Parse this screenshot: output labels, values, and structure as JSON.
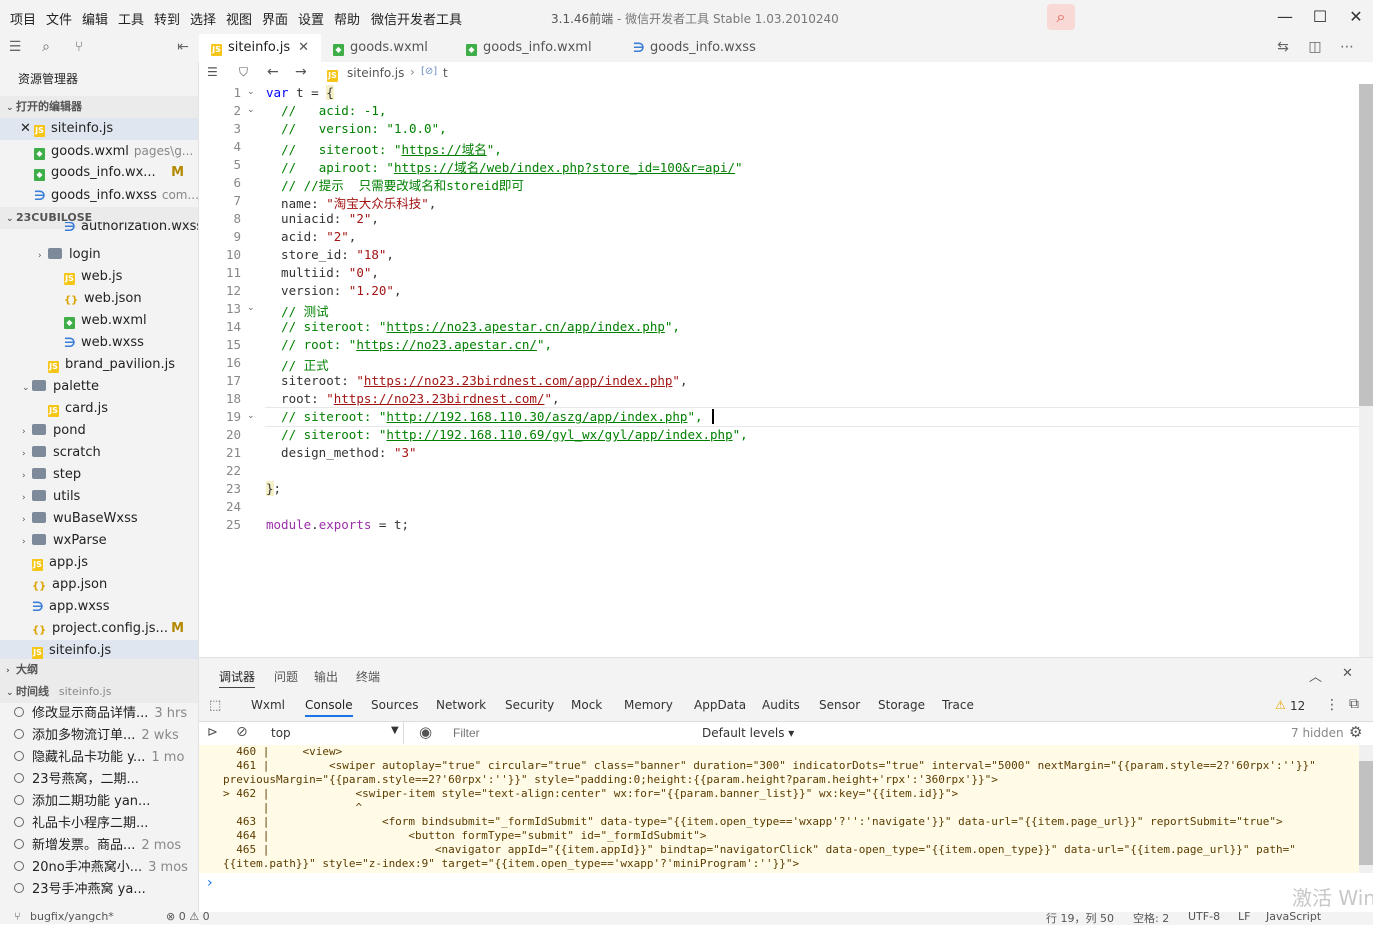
{
  "menu": [
    "项目",
    "文件",
    "编辑",
    "工具",
    "转到",
    "选择",
    "视图",
    "界面",
    "设置",
    "帮助",
    "微信开发者工具"
  ],
  "window": {
    "title_version": "3.1.46前端",
    "title_rest": " - 微信开发者工具 Stable 1.03.2010240"
  },
  "tabs": [
    {
      "label": "siteinfo.js",
      "type": "js",
      "active": true
    },
    {
      "label": "goods.wxml",
      "type": "wxml",
      "active": false
    },
    {
      "label": "goods_info.wxml",
      "type": "wxml",
      "active": false
    },
    {
      "label": "goods_info.wxss",
      "type": "wxss",
      "active": false
    }
  ],
  "sidebar": {
    "header": "资源管理器",
    "open_editors_title": "打开的编辑器",
    "open_editors": [
      {
        "label": "siteinfo.js",
        "type": "js",
        "hint": "",
        "mod": ""
      },
      {
        "label": "goods.wxml",
        "type": "wxml",
        "hint": "pages\\g...",
        "mod": ""
      },
      {
        "label": "goods_info.wx...",
        "type": "wxml",
        "hint": "",
        "mod": "M"
      },
      {
        "label": "goods_info.wxss",
        "type": "wxss",
        "hint": "com...",
        "mod": ""
      }
    ],
    "project_title": "23CUBILOSE",
    "tree": [
      {
        "label": "authorization.wxss",
        "type": "wxss",
        "indent": 3,
        "chev": ""
      },
      {
        "label": "login",
        "type": "folder",
        "indent": 2,
        "chev": "›"
      },
      {
        "label": "web.js",
        "type": "js",
        "indent": 3,
        "chev": ""
      },
      {
        "label": "web.json",
        "type": "json",
        "indent": 3,
        "chev": ""
      },
      {
        "label": "web.wxml",
        "type": "wxml",
        "indent": 3,
        "chev": ""
      },
      {
        "label": "web.wxss",
        "type": "wxss",
        "indent": 3,
        "chev": ""
      },
      {
        "label": "brand_pavilion.js",
        "type": "js",
        "indent": 2,
        "chev": ""
      },
      {
        "label": "palette",
        "type": "folder",
        "indent": 1,
        "chev": "⌄"
      },
      {
        "label": "card.js",
        "type": "js",
        "indent": 2,
        "chev": ""
      },
      {
        "label": "pond",
        "type": "folder",
        "indent": 1,
        "chev": "›"
      },
      {
        "label": "scratch",
        "type": "folder",
        "indent": 1,
        "chev": "›"
      },
      {
        "label": "step",
        "type": "folder",
        "indent": 1,
        "chev": "›"
      },
      {
        "label": "utils",
        "type": "folder",
        "indent": 1,
        "chev": "›"
      },
      {
        "label": "wuBaseWxss",
        "type": "folder",
        "indent": 1,
        "chev": "›"
      },
      {
        "label": "wxParse",
        "type": "folder",
        "indent": 1,
        "chev": "›"
      },
      {
        "label": "app.js",
        "type": "js",
        "indent": 1,
        "chev": ""
      },
      {
        "label": "app.json",
        "type": "json",
        "indent": 1,
        "chev": ""
      },
      {
        "label": "app.wxss",
        "type": "wxss",
        "indent": 1,
        "chev": ""
      },
      {
        "label": "project.config.js...",
        "type": "json",
        "indent": 1,
        "chev": "",
        "mod": "M"
      },
      {
        "label": "siteinfo.js",
        "type": "js",
        "indent": 1,
        "chev": "",
        "selected": true
      }
    ],
    "outline_title": "大纲",
    "timeline_title": "时间线",
    "timeline_file": "siteinfo.js",
    "timeline": [
      {
        "label": "修改显示商品详情...",
        "time": "3 hrs"
      },
      {
        "label": "添加多物流订单...",
        "time": "2 wks"
      },
      {
        "label": "隐藏礼品卡功能 y...",
        "time": "1 mo"
      },
      {
        "label": "23号燕窝，二期...",
        "time": ""
      },
      {
        "label": "添加二期功能 yan...",
        "time": ""
      },
      {
        "label": "礼品卡小程序二期...",
        "time": ""
      },
      {
        "label": "新增发票。商品...",
        "time": "2 mos"
      },
      {
        "label": "20no手冲燕窝小...",
        "time": "3 mos"
      },
      {
        "label": "23号手冲燕窝 ya...",
        "time": ""
      }
    ]
  },
  "breadcrumb": {
    "file": "siteinfo.js",
    "symbol": "t"
  },
  "code": [
    {
      "n": "1",
      "fold": "⌄",
      "html": "<span class='c-kw'>var</span> t = <span style='background:#f5f0c8'>{</span>"
    },
    {
      "n": "2",
      "fold": "⌄",
      "html": "  <span class='c-com'>//   acid: -1,</span>"
    },
    {
      "n": "3",
      "fold": "",
      "html": "  <span class='c-com'>//   version: \"1.0.0\",</span>"
    },
    {
      "n": "4",
      "fold": "",
      "html": "  <span class='c-com'>//   siteroot: \"<span class='c-url-c'>https://域名</span>\",</span>"
    },
    {
      "n": "5",
      "fold": "",
      "html": "  <span class='c-com'>//   apiroot: \"<span class='c-url-c'>https://域名/web/index.php?store_id=100&amp;r=api/</span>\"</span>"
    },
    {
      "n": "6",
      "fold": "",
      "html": "  <span class='c-com'>// //提示  只需要改域名和storeid即可</span>"
    },
    {
      "n": "7",
      "fold": "",
      "html": "  name: <span class='c-str'>\"淘宝大众乐科技\"</span>,"
    },
    {
      "n": "8",
      "fold": "",
      "html": "  uniacid: <span class='c-str'>\"2\"</span>,"
    },
    {
      "n": "9",
      "fold": "",
      "html": "  acid: <span class='c-str'>\"2\"</span>,"
    },
    {
      "n": "10",
      "fold": "",
      "html": "  store_id: <span class='c-str'>\"18\"</span>,"
    },
    {
      "n": "11",
      "fold": "",
      "html": "  multiid: <span class='c-str'>\"0\"</span>,"
    },
    {
      "n": "12",
      "fold": "",
      "html": "  version: <span class='c-str'>\"1.20\"</span>,"
    },
    {
      "n": "13",
      "fold": "⌄",
      "html": "  <span class='c-com'>// 测试</span>"
    },
    {
      "n": "14",
      "fold": "",
      "html": "  <span class='c-com'>// siteroot: \"<span class='c-url-c'>https://no23.apestar.cn/app/index.php</span>\",</span>"
    },
    {
      "n": "15",
      "fold": "",
      "html": "  <span class='c-com'>// root: \"<span class='c-url-c'>https://no23.apestar.cn/</span>\",</span>"
    },
    {
      "n": "16",
      "fold": "",
      "html": "  <span class='c-com'>// 正式</span>"
    },
    {
      "n": "17",
      "fold": "",
      "html": "  siteroot: <span class='c-str'>\"<span class='c-url'>https://no23.23birdnest.com/app/index.php</span>\"</span>,"
    },
    {
      "n": "18",
      "fold": "",
      "html": "  root: <span class='c-str'>\"<span class='c-url'>https://no23.23birdnest.com/</span>\"</span>,"
    },
    {
      "n": "19",
      "fold": "⌄",
      "html": "  <span class='c-com'>// siteroot: \"<span class='c-url-c'>http://192.168.110.30/aszg/app/index.php</span>\",</span>"
    },
    {
      "n": "20",
      "fold": "",
      "html": "  <span class='c-com'>// siteroot: \"<span class='c-url-c'>http://192.168.110.69/gyl_wx/gyl/app/index.php</span>\",</span>"
    },
    {
      "n": "21",
      "fold": "",
      "html": "  design_method: <span class='c-str'>\"3\"</span>"
    },
    {
      "n": "22",
      "fold": "",
      "html": ""
    },
    {
      "n": "23",
      "fold": "",
      "html": "<span style='background:#f5f0c8'>}</span>;"
    },
    {
      "n": "24",
      "fold": "",
      "html": ""
    },
    {
      "n": "25",
      "fold": "",
      "html": "<span style='color:#9b2fa8'>module</span>.<span style='color:#9b2fa8'>exports</span> = t;"
    }
  ],
  "panel": {
    "tabs": [
      "调试器",
      "问题",
      "输出",
      "终端"
    ],
    "devtools_tabs": [
      "Wxml",
      "Console",
      "Sources",
      "Network",
      "Security",
      "Mock",
      "Memory",
      "AppData",
      "Audits",
      "Sensor",
      "Storage",
      "Trace"
    ],
    "warnings": "12",
    "context": "top",
    "filter_placeholder": "Filter",
    "levels": "Default levels ▾",
    "hidden": "7 hidden",
    "console_lines": [
      "  460 |     <view>",
      "  461 |         <swiper autoplay=\"true\" circular=\"true\" class=\"banner\" duration=\"300\" indicatorDots=\"true\" interval=\"5000\" nextMargin=\"{{param.style==2?'60rpx':''}}\"",
      "previousMargin=\"{{param.style==2?'60rpx':''}}\" style=\"padding:0;height:{{param.height?param.height+'rpx':'360rpx'}}\">",
      "> 462 |             <swiper-item style=\"text-align:center\" wx:for=\"{{param.banner_list}}\" wx:key=\"{{item.id}}\">",
      "      |             ^",
      "  463 |                 <form bindsubmit=\"_formIdSubmit\" data-type=\"{{item.open_type=='wxapp'?'':'navigate'}}\" data-url=\"{{item.page_url}}\" reportSubmit=\"true\">",
      "  464 |                     <button formType=\"submit\" id=\"_formIdSubmit\">",
      "  465 |                         <navigator appId=\"{{item.appId}}\" bindtap=\"navigatorClick\" data-open_type=\"{{item.open_type}}\" data-url=\"{{item.page_url}}\" path=\"",
      "{{item.path}}\" style=\"z-index:9\" target=\"{{item.open_type=='wxapp'?'miniProgram':''}}\">"
    ],
    "prompt": "›"
  },
  "status": {
    "branch": "bugfix/yangch*",
    "errors": "⊗ 0 ⚠ 0",
    "position": "行 19，列 50",
    "spaces": "空格: 2",
    "encoding": "UTF-8",
    "eol": "LF",
    "lang": "JavaScript"
  },
  "watermark": "激活 Windows"
}
